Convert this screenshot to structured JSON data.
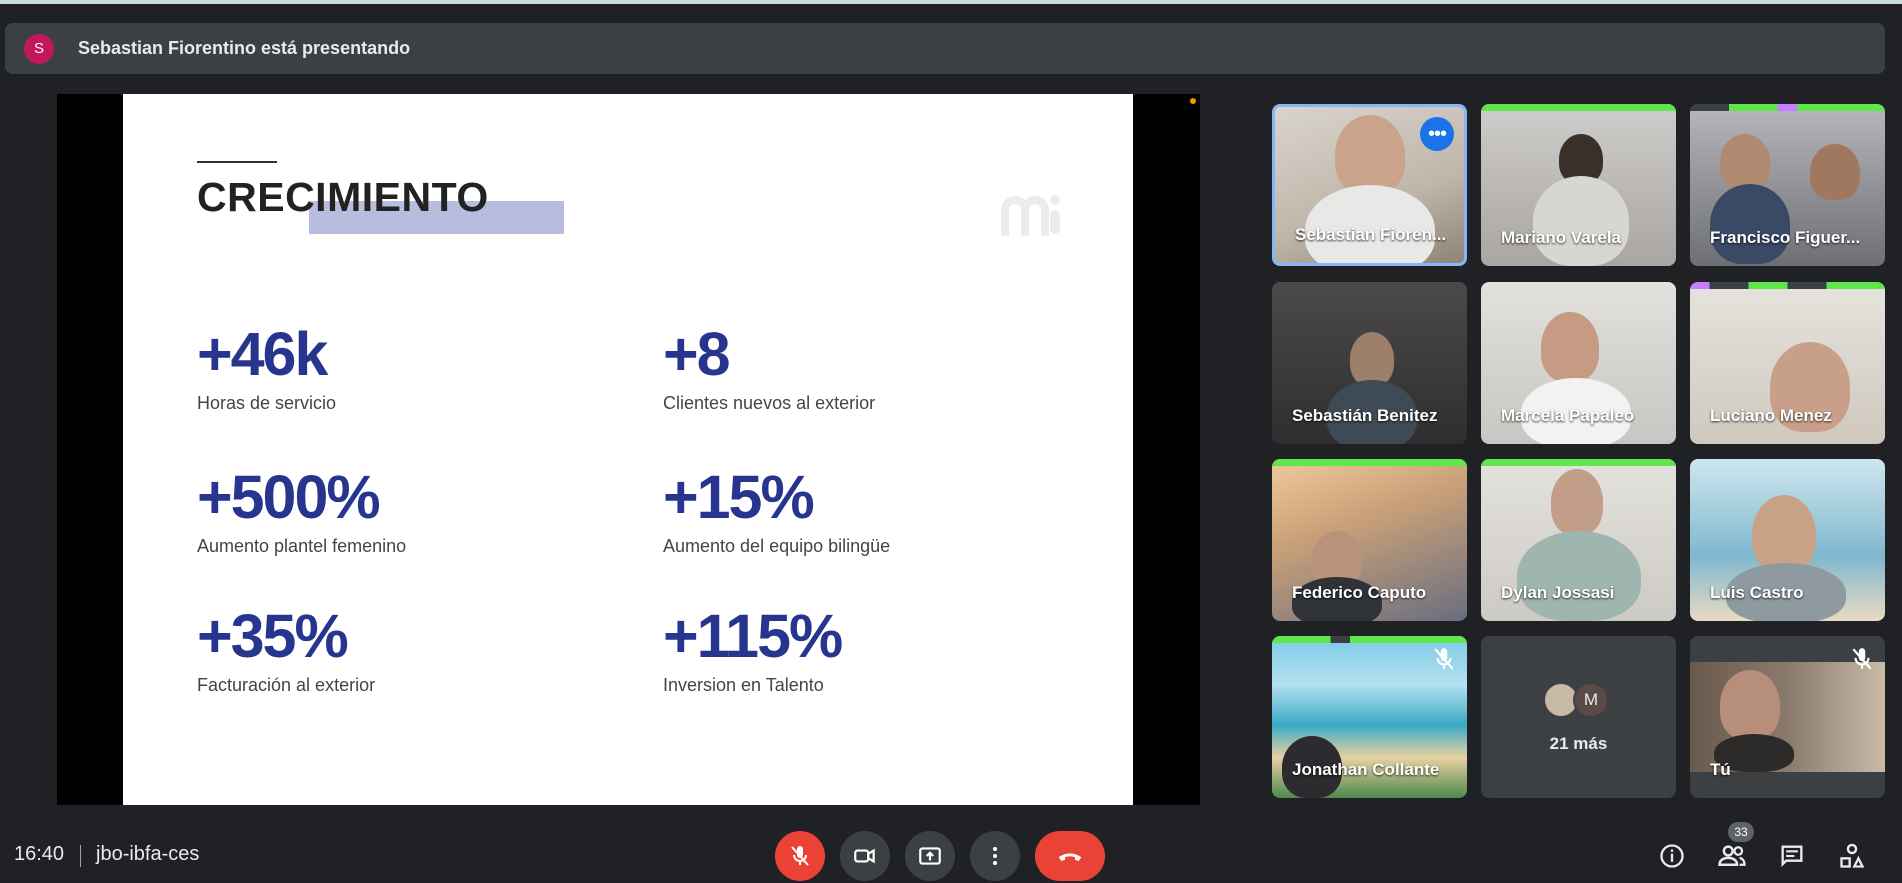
{
  "presenter": {
    "initial": "S",
    "text": "Sebastian Fiorentino está presentando"
  },
  "slide": {
    "title": "CRECIMIENTO",
    "stats": [
      {
        "value": "+46k",
        "label": "Horas de servicio"
      },
      {
        "value": "+8",
        "label": "Clientes nuevos al exterior"
      },
      {
        "value": "+500%",
        "label": "Aumento plantel femenino"
      },
      {
        "value": "+15%",
        "label": "Aumento del equipo bilingüe"
      },
      {
        "value": "+35%",
        "label": "Facturación al exterior"
      },
      {
        "value": "+115%",
        "label": "Inversion en Talento"
      }
    ]
  },
  "participants": [
    {
      "name": "Sebastian Fioren...",
      "active": true
    },
    {
      "name": "Mariano Varela"
    },
    {
      "name": "Francisco Figuer..."
    },
    {
      "name": "Sebastián Benitez"
    },
    {
      "name": "Marcela Papaleo"
    },
    {
      "name": "Luciano Menez"
    },
    {
      "name": "Federico Caputo"
    },
    {
      "name": "Dylan Jossasi"
    },
    {
      "name": "Luis Castro"
    },
    {
      "name": "Jonathan Collante",
      "muted": true
    },
    {
      "name": "Tú",
      "muted": true
    }
  ],
  "more": {
    "initial": "M",
    "label": "21 más"
  },
  "meeting": {
    "time": "16:40",
    "code": "jbo-ibfa-ces"
  },
  "people_count": "33",
  "colors": {
    "background": "#202124",
    "surface": "#3c4043",
    "end_call": "#ea4335",
    "accent_blue": "#1a73e8",
    "slide_number_color": "#27358f"
  },
  "icons": [
    "mic-off-icon",
    "camera-icon",
    "present-icon",
    "more-vert-icon",
    "hang-up-icon",
    "info-icon",
    "people-icon",
    "chat-icon",
    "activities-icon"
  ]
}
